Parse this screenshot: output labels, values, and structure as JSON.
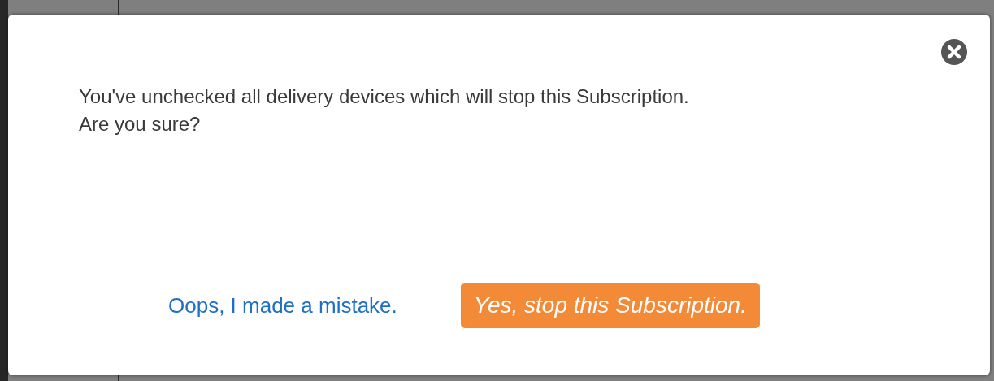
{
  "dialog": {
    "message_lines": [
      "You've unchecked all delivery devices which will stop this Subscription.",
      "Are you sure?"
    ],
    "cancel_link": "Oops, I made a mistake.",
    "confirm_button": "Yes, stop this Subscription."
  }
}
